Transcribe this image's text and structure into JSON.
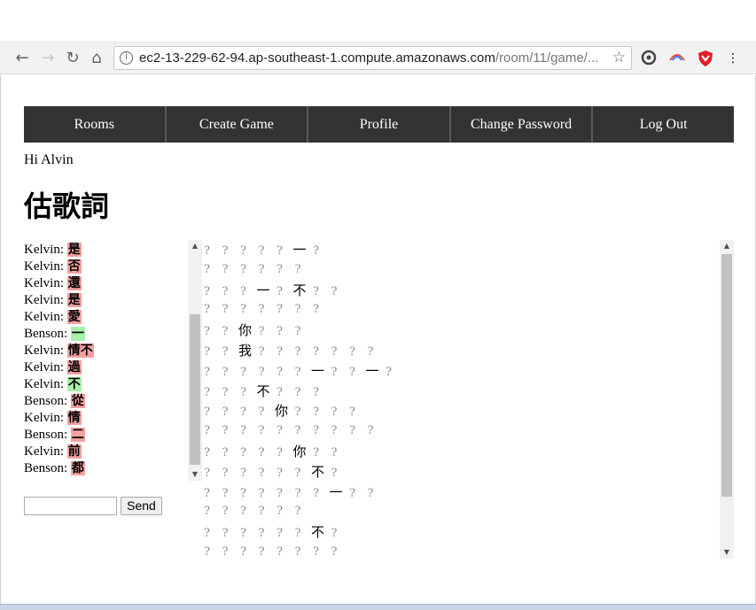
{
  "browser": {
    "url_host": "ec2-13-229-62-94.ap-southeast-1.compute.amazonaws.com",
    "url_path": "/room/11/game/...",
    "icons": [
      "back-icon",
      "forward-icon",
      "reload-icon",
      "home-icon",
      "info-icon",
      "star-icon",
      "extension-icon",
      "rainbow-extension-icon",
      "shield-extension-icon",
      "menu-dots-icon"
    ]
  },
  "nav": {
    "items": [
      "Rooms",
      "Create Game",
      "Profile",
      "Change Password",
      "Log Out"
    ]
  },
  "greeting": "Hi Alvin",
  "title": "估歌詞",
  "chat": {
    "messages": [
      {
        "name": "Kelvin:",
        "guess": "是",
        "status": "wrong"
      },
      {
        "name": "Kelvin:",
        "guess": "否",
        "status": "wrong"
      },
      {
        "name": "Kelvin:",
        "guess": "還",
        "status": "wrong"
      },
      {
        "name": "Kelvin:",
        "guess": "是",
        "status": "wrong"
      },
      {
        "name": "Kelvin:",
        "guess": "愛",
        "status": "wrong"
      },
      {
        "name": "Benson:",
        "guess": "一",
        "status": "right"
      },
      {
        "name": "Kelvin:",
        "guess": "情不",
        "status": "wrong"
      },
      {
        "name": "Kelvin:",
        "guess": "過",
        "status": "wrong"
      },
      {
        "name": "Kelvin:",
        "guess": "不",
        "status": "right"
      },
      {
        "name": "Benson:",
        "guess": "從",
        "status": "wrong"
      },
      {
        "name": "Kelvin:",
        "guess": "情",
        "status": "wrong"
      },
      {
        "name": "Benson:",
        "guess": "二",
        "status": "wrong"
      },
      {
        "name": "Kelvin:",
        "guess": "前",
        "status": "wrong"
      },
      {
        "name": "Benson:",
        "guess": "都",
        "status": "wrong"
      }
    ],
    "input_value": "",
    "send_label": "Send"
  },
  "lyrics": {
    "lines": [
      [
        "?",
        "?",
        "?",
        "?",
        "?",
        "一",
        "?"
      ],
      [
        "?",
        "?",
        "?",
        "?",
        "?",
        "?"
      ],
      [
        "?",
        "?",
        "?",
        "一",
        "?",
        "不",
        "?",
        "?"
      ],
      [
        "?",
        "?",
        "?",
        "?",
        "?",
        "?",
        "?"
      ],
      [
        "?",
        "?",
        "你",
        "?",
        "?",
        "?"
      ],
      [
        "?",
        "?",
        "我",
        "?",
        "?",
        "?",
        "?",
        "?",
        "?",
        "?"
      ],
      [
        "?",
        "?",
        "?",
        "?",
        "?",
        "?",
        "一",
        "?",
        "?",
        "一",
        "?"
      ],
      [
        "?",
        "?",
        "?",
        "不",
        "?",
        "?",
        "?"
      ],
      [
        "?",
        "?",
        "?",
        "?",
        "你",
        "?",
        "?",
        "?",
        "?"
      ],
      [
        "?",
        "?",
        "?",
        "?",
        "?",
        "?",
        "?",
        "?",
        "?",
        "?"
      ],
      [
        "?",
        "?",
        "?",
        "?",
        "?",
        "你",
        "?",
        "?"
      ],
      [
        "?",
        "?",
        "?",
        "?",
        "?",
        "?",
        "不",
        "?"
      ],
      [
        "?",
        "?",
        "?",
        "?",
        "?",
        "?",
        "?",
        "一",
        "?",
        "?"
      ],
      [
        "?",
        "?",
        "?",
        "?",
        "?",
        "?"
      ],
      [
        "?",
        "?",
        "?",
        "?",
        "?",
        "?",
        "不",
        "?"
      ],
      [
        "?",
        "?",
        "?",
        "?",
        "?",
        "?",
        "?",
        "?"
      ]
    ]
  },
  "colors": {
    "menu_bg": "#333333",
    "wrong_guess": "#f4a0a0",
    "right_guess": "#a8f0a8",
    "hidden_char": "#8c8c8c"
  }
}
